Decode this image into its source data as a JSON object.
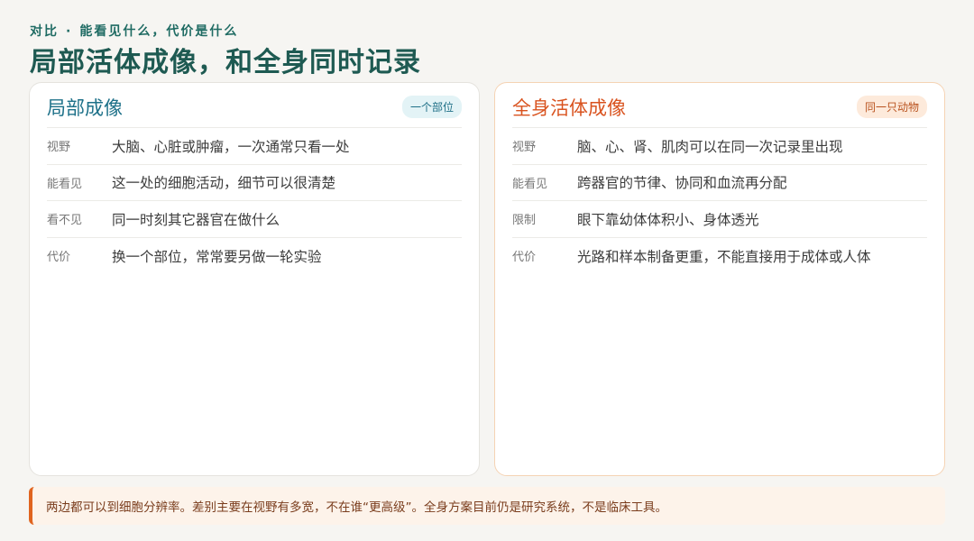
{
  "header": {
    "eyebrow_a": "对比",
    "eyebrow_sep": "·",
    "eyebrow_b": "能看见什么，代价是什么",
    "title": "局部活体成像，和全身同时记录"
  },
  "left_card": {
    "title": "局部成像",
    "tag": "一个部位",
    "rows": [
      {
        "label": "视野",
        "value": "大脑、心脏或肿瘤，一次通常只看一处"
      },
      {
        "label": "能看见",
        "value": "这一处的细胞活动，细节可以很清楚"
      },
      {
        "label": "看不见",
        "value": "同一时刻其它器官在做什么"
      },
      {
        "label": "代价",
        "value": "换一个部位，常常要另做一轮实验"
      }
    ]
  },
  "right_card": {
    "title": "全身活体成像",
    "tag": "同一只动物",
    "rows": [
      {
        "label": "视野",
        "value": "脑、心、肾、肌肉可以在同一次记录里出现"
      },
      {
        "label": "能看见",
        "value": "跨器官的节律、协同和血流再分配"
      },
      {
        "label": "限制",
        "value": "眼下靠幼体体积小、身体透光"
      },
      {
        "label": "代价",
        "value": "光路和样本制备更重，不能直接用于成体或人体"
      }
    ]
  },
  "note": {
    "text": "两边都可以到细胞分辨率。差别主要在视野有多宽，不在谁“更高级”。全身方案目前仍是研究系统，不是临床工具。"
  },
  "colors": {
    "accent_teal": "#1e7189",
    "accent_orange": "#d9531f",
    "title_green": "#1e5a52"
  }
}
